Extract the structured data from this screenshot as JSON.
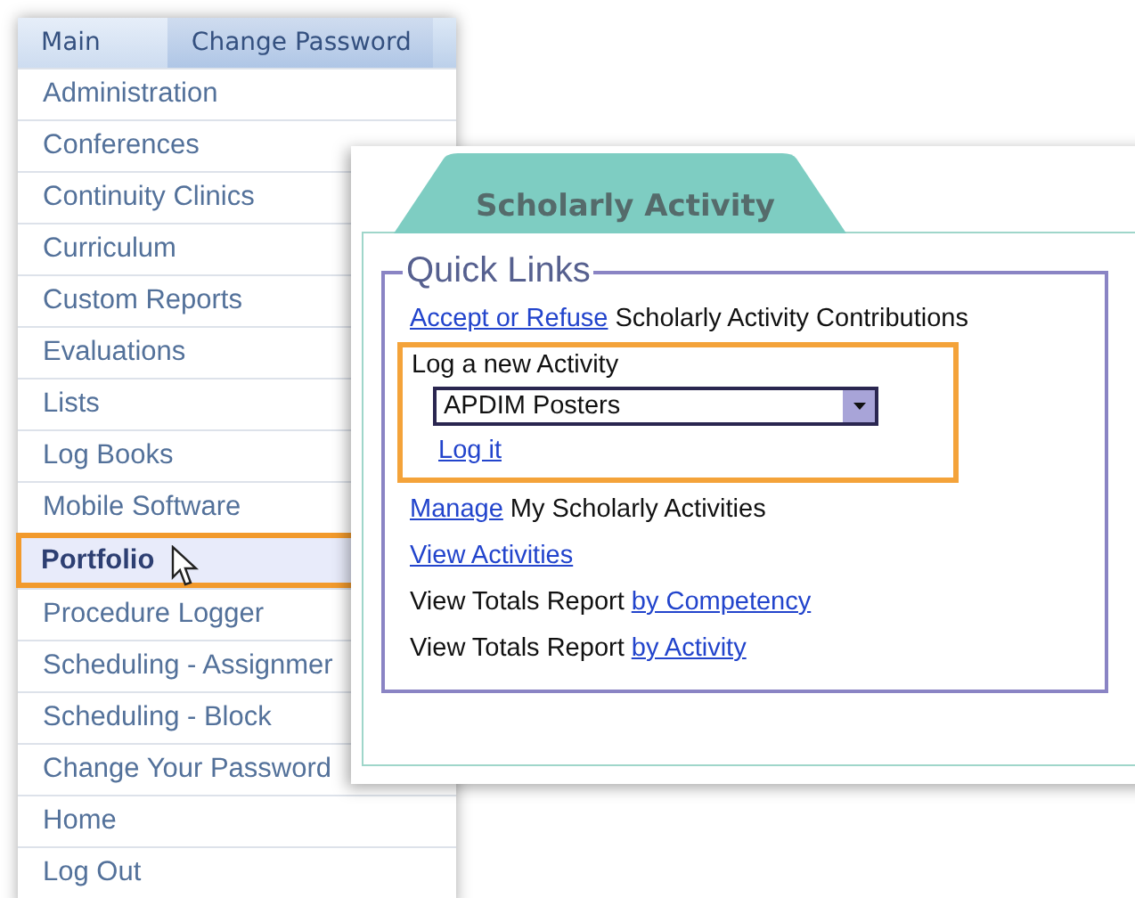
{
  "menu": {
    "tabs": [
      {
        "label": "Main",
        "selected": true
      },
      {
        "label": "Change Password",
        "selected": false
      }
    ],
    "items": [
      {
        "label": "Administration",
        "selected": false
      },
      {
        "label": "Conferences",
        "selected": false
      },
      {
        "label": "Continuity Clinics",
        "selected": false
      },
      {
        "label": "Curriculum",
        "selected": false
      },
      {
        "label": "Custom Reports",
        "selected": false
      },
      {
        "label": "Evaluations",
        "selected": false
      },
      {
        "label": "Lists",
        "selected": false
      },
      {
        "label": "Log Books",
        "selected": false
      },
      {
        "label": "Mobile Software",
        "selected": false
      },
      {
        "label": "Portfolio",
        "selected": true
      },
      {
        "label": "Procedure Logger",
        "selected": false
      },
      {
        "label": "Scheduling - Assignmer",
        "selected": false
      },
      {
        "label": "Scheduling - Block",
        "selected": false
      },
      {
        "label": "Change Your Password",
        "selected": false
      },
      {
        "label": "Home",
        "selected": false
      },
      {
        "label": "Log Out",
        "selected": false
      }
    ]
  },
  "popup": {
    "tab": "Scholarly Activity",
    "legend": "Quick Links",
    "lines": [
      {
        "kind": "link-first",
        "link": "Accept or Refuse",
        "text": "Scholarly Activity Contributions"
      },
      {
        "kind": "form",
        "label": "Log a new Activity",
        "value": "APDIM Posters",
        "link": "Log it",
        "highlighted": true
      },
      {
        "kind": "link-first",
        "link": "Manage",
        "text": "My Scholarly Activities"
      },
      {
        "kind": "link",
        "link": "View Activities"
      },
      {
        "kind": "text-first",
        "text": "View Totals Report",
        "link": "by Competency"
      },
      {
        "kind": "text-first",
        "text": "View Totals Report",
        "link": "by Activity"
      }
    ]
  }
}
